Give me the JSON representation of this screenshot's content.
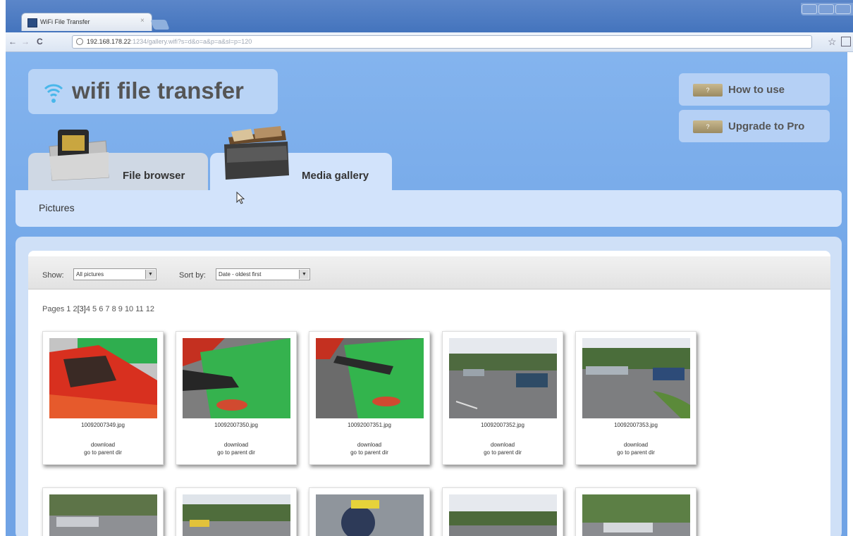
{
  "browser": {
    "tab_title": "WiFi File Transfer",
    "tab_close": "×",
    "url_host": "192.168.178.22",
    "url_rest": ":1234/gallery.wifi?s=d&o=a&p=a&sl=p=120"
  },
  "app": {
    "logo_text": "wifi file transfer",
    "side_buttons": [
      {
        "label": "How to use"
      },
      {
        "label": "Upgrade to Pro"
      }
    ],
    "tabs": [
      {
        "label": "File browser"
      },
      {
        "label": "Media gallery"
      }
    ],
    "subnav": "Pictures"
  },
  "filters": {
    "show_label": "Show:",
    "show_value": "All pictures",
    "sort_label": "Sort by:",
    "sort_value": "Date - oldest first"
  },
  "pagination": {
    "label": "Pages",
    "pages": [
      "1",
      "2",
      "[3]",
      "4",
      "5",
      "6",
      "7",
      "8",
      "9",
      "10",
      "11",
      "12"
    ],
    "current": "3"
  },
  "gallery": {
    "items": [
      {
        "filename": "10092007349.jpg",
        "download": "download",
        "parent": "go to parent dir"
      },
      {
        "filename": "10092007350.jpg",
        "download": "download",
        "parent": "go to parent dir"
      },
      {
        "filename": "10092007351.jpg",
        "download": "download",
        "parent": "go to parent dir"
      },
      {
        "filename": "10092007352.jpg",
        "download": "download",
        "parent": "go to parent dir"
      },
      {
        "filename": "10092007353.jpg",
        "download": "download",
        "parent": "go to parent dir"
      }
    ]
  },
  "colors": {
    "page_bg": "#7fb0ec",
    "panel_bg": "#d2e3fb",
    "logo_bg": "#b9d4f6"
  }
}
